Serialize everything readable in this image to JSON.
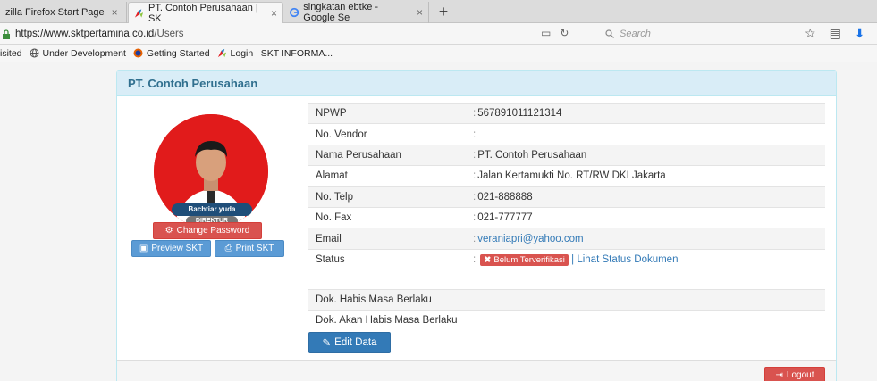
{
  "browser": {
    "tabs": [
      {
        "title": "zilla Firefox Start Page",
        "close": "×"
      },
      {
        "title": "PT. Contoh Perusahaan | SK",
        "close": "×"
      },
      {
        "title": "singkatan ebtke - Google Se",
        "close": "×"
      }
    ],
    "new_tab": "+",
    "url_host": "https://www.sktpertamina.co.id",
    "url_path": "/Users",
    "search_placeholder": "Search",
    "bookmarks": [
      "isited",
      "Under Development",
      "Getting Started",
      "Login | SKT INFORMA..."
    ]
  },
  "panel": {
    "title": "PT. Contoh Perusahaan"
  },
  "profile": {
    "name": "Bachtiar yuda",
    "role": "DIREKTUR",
    "change_password": "Change Password",
    "preview_skt": "Preview SKT",
    "print_skt": "Print SKT"
  },
  "info": {
    "rows": [
      {
        "label": "NPWP",
        "value": "567891011121314"
      },
      {
        "label": "No. Vendor",
        "value": ""
      },
      {
        "label": "Nama Perusahaan",
        "value": "PT. Contoh Perusahaan"
      },
      {
        "label": "Alamat",
        "value": "Jalan Kertamukti No. RT/RW DKI Jakarta"
      },
      {
        "label": "No. Telp",
        "value": "021-888888"
      },
      {
        "label": "No. Fax",
        "value": "021-777777"
      },
      {
        "label": "Email",
        "value": "veraniapri@yahoo.com"
      },
      {
        "label": "Status",
        "value": ""
      }
    ],
    "status_badge": "Belum Terverifikasi",
    "status_separator": "|",
    "status_link": "Lihat Status Dokumen",
    "colon": ":"
  },
  "documents": {
    "rows": [
      "Dok. Habis Masa Berlaku",
      "Dok. Akan Habis Masa Berlaku"
    ]
  },
  "actions": {
    "edit_data": "Edit Data",
    "logout": "Logout"
  },
  "colors": {
    "accent": "#337ab7",
    "danger": "#d9534f",
    "panel_heading": "#d9edf7"
  }
}
